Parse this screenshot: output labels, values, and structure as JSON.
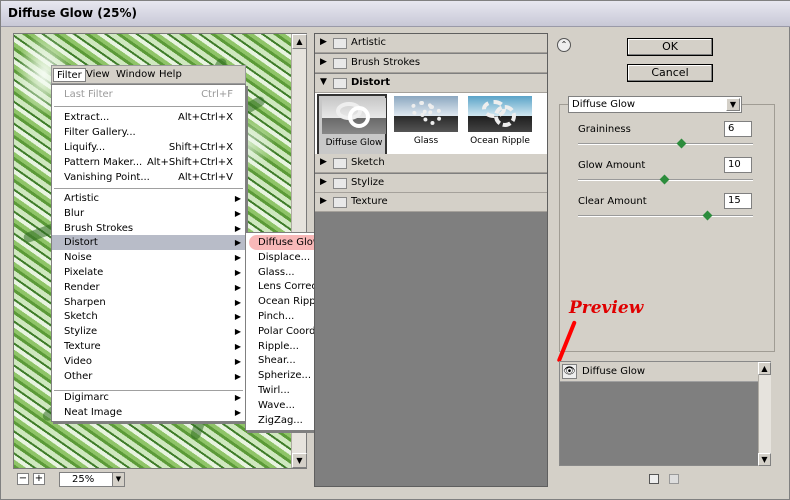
{
  "window": {
    "title": "Diffuse Glow (25%)"
  },
  "zoom": {
    "value": "25%",
    "minus": "−",
    "plus": "+"
  },
  "menubar": [
    "Filter",
    "View",
    "Window",
    "Help"
  ],
  "filter_menu": {
    "last_filter": {
      "label": "Last Filter",
      "shortcut": "Ctrl+F"
    },
    "top_items": [
      {
        "label": "Extract...",
        "shortcut": "Alt+Ctrl+X"
      },
      {
        "label": "Filter Gallery..."
      },
      {
        "label": "Liquify...",
        "shortcut": "Shift+Ctrl+X"
      },
      {
        "label": "Pattern Maker...",
        "shortcut": "Alt+Shift+Ctrl+X"
      },
      {
        "label": "Vanishing Point...",
        "shortcut": "Alt+Ctrl+V"
      }
    ],
    "categories": [
      "Artistic",
      "Blur",
      "Brush Strokes",
      "Distort",
      "Noise",
      "Pixelate",
      "Render",
      "Sharpen",
      "Sketch",
      "Stylize",
      "Texture",
      "Video",
      "Other"
    ],
    "bottom": [
      "Digimarc",
      "Neat Image"
    ]
  },
  "distort_submenu": [
    "Diffuse Glow...",
    "Displace...",
    "Glass...",
    "Lens Correction...",
    "Ocean Ripple...",
    "Pinch...",
    "Polar Coordinates...",
    "Ripple...",
    "Shear...",
    "Spherize...",
    "Twirl...",
    "Wave...",
    "ZigZag..."
  ],
  "gallery": {
    "categories_before": [
      "Artistic",
      "Brush Strokes"
    ],
    "open_category": "Distort",
    "thumbnails": [
      "Diffuse Glow",
      "Glass",
      "Ocean Ripple"
    ],
    "categories_after": [
      "Sketch",
      "Stylize",
      "Texture"
    ]
  },
  "buttons": {
    "ok": "OK",
    "cancel": "Cancel"
  },
  "filter_select": "Diffuse Glow",
  "params": [
    {
      "label": "Graininess",
      "value": "6",
      "level": 0.6
    },
    {
      "label": "Glow Amount",
      "value": "10",
      "level": 0.5
    },
    {
      "label": "Clear Amount",
      "value": "15",
      "level": 0.75
    }
  ],
  "layer": {
    "name": "Diffuse Glow"
  },
  "annotation": {
    "text": "Preview",
    "color": "#e00000"
  },
  "icons": {
    "collapse": "double-chevron-up-icon",
    "eye": "eye-icon",
    "new_layer": "new-layer-icon",
    "delete": "trash-icon"
  }
}
